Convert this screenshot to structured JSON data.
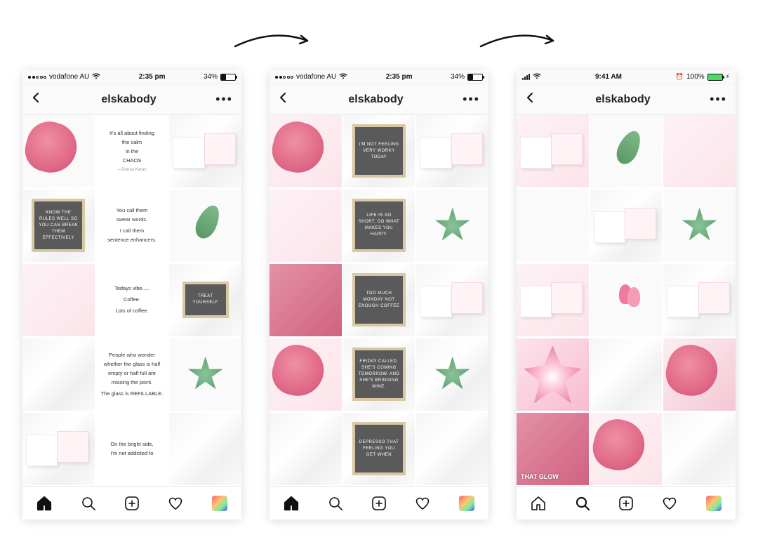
{
  "arrows": {
    "count": 2
  },
  "phones": [
    {
      "status": {
        "signal_type": "dots",
        "carrier": "vodafone AU",
        "wifi": true,
        "time": "2:35 pm",
        "battery_pct": "34%",
        "battery_fill": 34,
        "alarm": false,
        "charging": false
      },
      "header": {
        "title": "elskabody"
      },
      "tabs": {
        "active": "home"
      },
      "grid": [
        {
          "kind": "photo",
          "variant": "peony",
          "bg": "bg-white"
        },
        {
          "kind": "text",
          "lines": [
            "It's all about finding",
            "the calm",
            "in the",
            "CHAOS"
          ],
          "author": "—Donna Karan"
        },
        {
          "kind": "photo",
          "variant": "box-item",
          "bg": "bg-marble"
        },
        {
          "kind": "letterboard",
          "text": "KNOW THE RULES WELL SO YOU CAN BREAK THEM EFFECTIVELY"
        },
        {
          "kind": "text",
          "lines": [
            "You call them",
            "swear words.",
            "",
            "I call them",
            "sentence enhancers."
          ]
        },
        {
          "kind": "photo",
          "variant": "leaf",
          "bg": "bg-white"
        },
        {
          "kind": "photo",
          "variant": "",
          "bg": "bg-softpink"
        },
        {
          "kind": "text",
          "lines": [
            "Todays vibe.....",
            "",
            "Coffee.",
            "",
            "Lots of coffee."
          ]
        },
        {
          "kind": "letterboard",
          "text": "TREAT YOURSELF",
          "bg": "bg-marble",
          "small": true
        },
        {
          "kind": "photo",
          "variant": "",
          "bg": "bg-marble"
        },
        {
          "kind": "text",
          "lines": [
            "People who wonder",
            "whether the glass is half",
            "empty or half full are",
            "missing the point.",
            "",
            "The glass is REFILLABLE."
          ]
        },
        {
          "kind": "photo",
          "variant": "succulent",
          "bg": "bg-white"
        },
        {
          "kind": "photo",
          "variant": "box-item",
          "bg": "bg-marble"
        },
        {
          "kind": "text",
          "lines": [
            "On the bright side,",
            "I'm not addicted to"
          ]
        },
        {
          "kind": "photo",
          "variant": "",
          "bg": "bg-marble"
        }
      ]
    },
    {
      "status": {
        "signal_type": "dots",
        "carrier": "vodafone AU",
        "wifi": true,
        "time": "2:35 pm",
        "battery_pct": "34%",
        "battery_fill": 34,
        "alarm": false,
        "charging": false
      },
      "header": {
        "title": "elskabody"
      },
      "tabs": {
        "active": "home"
      },
      "grid": [
        {
          "kind": "photo",
          "variant": "peony",
          "bg": "bg-softpink"
        },
        {
          "kind": "letterboard",
          "text": "I'M NOT FEELING VERY WORKY TODAY"
        },
        {
          "kind": "photo",
          "variant": "box-item",
          "bg": "bg-marble"
        },
        {
          "kind": "photo",
          "variant": "",
          "bg": "bg-softpink"
        },
        {
          "kind": "letterboard",
          "text": "LIFE IS SO SHORT. DO WHAT MAKES YOU HAPPY."
        },
        {
          "kind": "photo",
          "variant": "succulent",
          "bg": "bg-white"
        },
        {
          "kind": "photo",
          "variant": "",
          "bg": "bg-deeppink"
        },
        {
          "kind": "letterboard",
          "text": "TOO MUCH MONDAY NOT ENOUGH COFFEE"
        },
        {
          "kind": "photo",
          "variant": "box-item",
          "bg": "bg-marble"
        },
        {
          "kind": "photo",
          "variant": "peony",
          "bg": "bg-softpink"
        },
        {
          "kind": "letterboard",
          "text": "FRIDAY CALLED. SHE'S COMING TOMORROW. AND SHE'S BRINGING WINE."
        },
        {
          "kind": "photo",
          "variant": "succulent",
          "bg": "bg-marble"
        },
        {
          "kind": "photo",
          "variant": "",
          "bg": "bg-marble"
        },
        {
          "kind": "letterboard",
          "text": "DEPRESSO THAT FEELING YOU GET WHEN"
        },
        {
          "kind": "photo",
          "variant": "",
          "bg": "bg-marble"
        }
      ]
    },
    {
      "status": {
        "signal_type": "bars",
        "carrier": "",
        "wifi": true,
        "time": "9:41 AM",
        "battery_pct": "100%",
        "battery_fill": 100,
        "battery_green": true,
        "alarm": true,
        "charging": true
      },
      "header": {
        "title": "elskabody"
      },
      "tabs": {
        "active": "search"
      },
      "grid": [
        {
          "kind": "photo",
          "variant": "box-item",
          "bg": "bg-softpink"
        },
        {
          "kind": "photo",
          "variant": "leaf",
          "bg": "bg-white"
        },
        {
          "kind": "photo",
          "variant": "",
          "bg": "bg-softpink"
        },
        {
          "kind": "photo",
          "variant": "",
          "bg": "bg-white"
        },
        {
          "kind": "photo",
          "variant": "box-item",
          "bg": "bg-marble"
        },
        {
          "kind": "photo",
          "variant": "succulent",
          "bg": "bg-white"
        },
        {
          "kind": "photo",
          "variant": "box-item",
          "bg": "bg-softpink"
        },
        {
          "kind": "photo",
          "variant": "tulip",
          "bg": "bg-white"
        },
        {
          "kind": "photo",
          "variant": "box-item",
          "bg": "bg-marble"
        },
        {
          "kind": "photo",
          "variant": "lily",
          "bg": "bg-pink"
        },
        {
          "kind": "photo",
          "variant": "",
          "bg": "bg-marble"
        },
        {
          "kind": "photo",
          "variant": "peony",
          "bg": "bg-rose"
        },
        {
          "kind": "photo",
          "variant": "",
          "bg": "bg-deeppink",
          "label": "THAT GLOW"
        },
        {
          "kind": "photo",
          "variant": "peony",
          "bg": "bg-softpink"
        },
        {
          "kind": "photo",
          "variant": "",
          "bg": "bg-marble"
        }
      ]
    }
  ],
  "icons": {
    "wifi": "wifi-icon",
    "alarm": "⏰",
    "bolt": "⚡︎"
  }
}
